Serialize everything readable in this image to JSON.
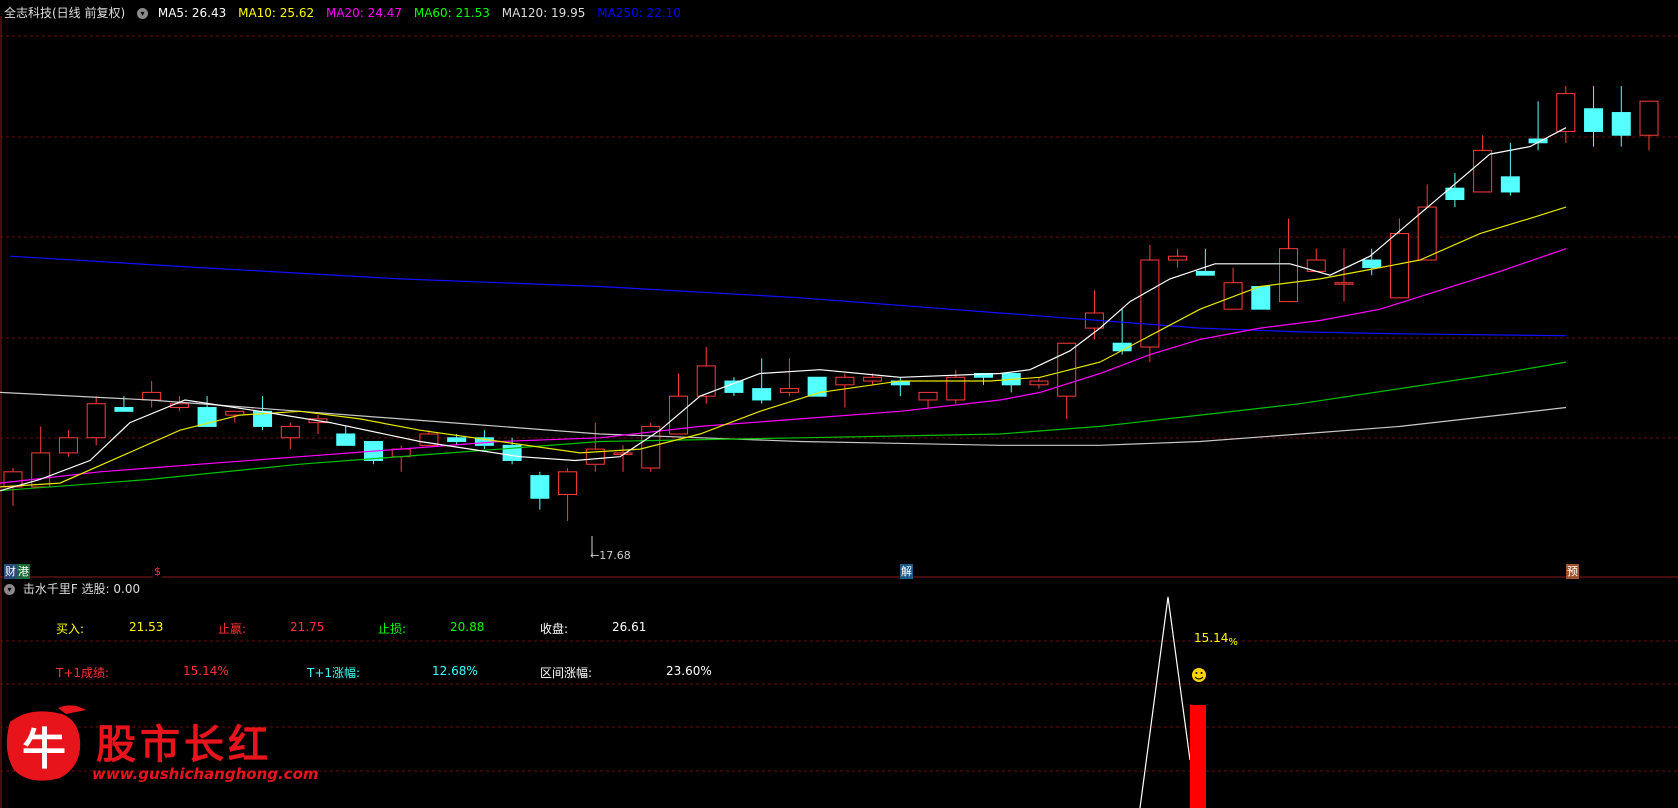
{
  "header": {
    "title": "全志科技(日线 前复权)",
    "toggle_icon": "chevron-down-icon",
    "indicators": [
      {
        "label": "MA5: 26.43",
        "color": "#ffffff"
      },
      {
        "label": "MA10: 25.62",
        "color": "#ffff00"
      },
      {
        "label": "MA20: 24.47",
        "color": "#ff00ff"
      },
      {
        "label": "MA60: 21.53",
        "color": "#00ff00"
      },
      {
        "label": "MA120: 19.95",
        "color": "#dcdcdc"
      },
      {
        "label": "MA250: 22.10",
        "color": "#0000ff"
      }
    ]
  },
  "main_chart": {
    "price_range": [
      16.8,
      31.0
    ],
    "low_marker": "←17.68",
    "candles": [
      [
        18.6,
        19.0,
        18.1,
        19.1
      ],
      [
        18.6,
        19.5,
        18.6,
        20.2
      ],
      [
        19.5,
        19.9,
        19.4,
        20.1
      ],
      [
        19.9,
        20.8,
        19.7,
        21.0
      ],
      [
        20.7,
        20.6,
        20.6,
        21.0
      ],
      [
        20.9,
        21.1,
        20.7,
        21.4
      ],
      [
        20.7,
        20.8,
        20.6,
        21.0
      ],
      [
        20.7,
        20.2,
        20.2,
        21.0
      ],
      [
        20.5,
        20.6,
        20.3,
        20.6
      ],
      [
        20.6,
        20.2,
        20.1,
        21.0
      ],
      [
        19.9,
        20.2,
        19.6,
        20.3
      ],
      [
        20.3,
        20.4,
        20.0,
        20.5
      ],
      [
        20.0,
        19.7,
        19.7,
        20.2
      ],
      [
        19.8,
        19.3,
        19.2,
        19.8
      ],
      [
        19.4,
        19.6,
        19.0,
        19.7
      ],
      [
        19.7,
        20.0,
        19.7,
        20.1
      ],
      [
        19.9,
        19.8,
        19.7,
        20.0
      ],
      [
        19.9,
        19.7,
        19.6,
        20.1
      ],
      [
        19.7,
        19.3,
        19.2,
        19.9
      ],
      [
        18.9,
        18.3,
        18.0,
        19.0
      ],
      [
        18.4,
        19.0,
        17.7,
        19.1
      ],
      [
        19.2,
        19.6,
        19.0,
        20.3
      ],
      [
        19.5,
        19.5,
        19.0,
        19.7
      ],
      [
        19.1,
        20.2,
        19.0,
        20.3
      ],
      [
        20.0,
        21.0,
        20.0,
        21.6
      ],
      [
        21.0,
        21.8,
        20.8,
        22.3
      ],
      [
        21.4,
        21.1,
        21.0,
        21.5
      ],
      [
        21.2,
        20.9,
        20.8,
        22.0
      ],
      [
        21.1,
        21.2,
        21.0,
        22.0
      ],
      [
        21.5,
        21.0,
        21.0,
        21.5
      ],
      [
        21.3,
        21.5,
        20.7,
        21.6
      ],
      [
        21.4,
        21.5,
        21.3,
        21.6
      ],
      [
        21.4,
        21.3,
        21.0,
        21.5
      ],
      [
        20.9,
        21.1,
        20.7,
        21.1
      ],
      [
        20.9,
        21.5,
        20.8,
        21.7
      ],
      [
        21.6,
        21.5,
        21.3,
        21.6
      ],
      [
        21.6,
        21.3,
        21.1,
        21.6
      ],
      [
        21.3,
        21.4,
        21.2,
        21.5
      ],
      [
        21.0,
        22.4,
        20.4,
        22.4
      ],
      [
        22.8,
        23.2,
        22.5,
        23.8
      ],
      [
        22.4,
        22.2,
        22.1,
        23.3
      ],
      [
        22.3,
        24.6,
        21.9,
        25.0
      ],
      [
        24.6,
        24.7,
        24.4,
        24.9
      ],
      [
        24.3,
        24.2,
        24.2,
        24.9
      ],
      [
        23.3,
        24.0,
        23.3,
        24.4
      ],
      [
        23.9,
        23.3,
        23.3,
        23.9
      ],
      [
        23.5,
        24.9,
        23.5,
        25.7
      ],
      [
        24.3,
        24.6,
        24.3,
        24.9
      ],
      [
        24.0,
        24.0,
        23.5,
        24.9
      ],
      [
        24.6,
        24.4,
        24.2,
        24.9
      ],
      [
        23.6,
        25.3,
        23.6,
        25.7
      ],
      [
        24.6,
        26.0,
        24.6,
        26.6
      ],
      [
        26.5,
        26.2,
        26.0,
        26.9
      ],
      [
        26.4,
        27.5,
        26.4,
        27.9
      ],
      [
        26.8,
        26.4,
        26.3,
        27.7
      ],
      [
        27.8,
        27.7,
        27.5,
        28.8
      ],
      [
        28.0,
        29.0,
        27.7,
        29.2
      ],
      [
        28.6,
        28.0,
        27.6,
        29.2
      ],
      [
        28.5,
        27.9,
        27.6,
        29.2
      ],
      [
        27.9,
        28.8,
        27.5,
        28.8
      ]
    ],
    "ma5": [
      [
        0,
        18.5
      ],
      [
        40,
        18.8
      ],
      [
        90,
        19.3
      ],
      [
        130,
        20.3
      ],
      [
        185,
        20.9
      ],
      [
        260,
        20.6
      ],
      [
        330,
        20.3
      ],
      [
        420,
        19.8
      ],
      [
        520,
        19.4
      ],
      [
        575,
        19.3
      ],
      [
        620,
        19.4
      ],
      [
        660,
        20.1
      ],
      [
        700,
        21.0
      ],
      [
        760,
        21.6
      ],
      [
        820,
        21.7
      ],
      [
        900,
        21.5
      ],
      [
        1000,
        21.6
      ],
      [
        1030,
        21.7
      ],
      [
        1070,
        22.2
      ],
      [
        1100,
        22.8
      ],
      [
        1130,
        23.5
      ],
      [
        1170,
        24.1
      ],
      [
        1215,
        24.5
      ],
      [
        1260,
        24.5
      ],
      [
        1290,
        24.5
      ],
      [
        1330,
        24.2
      ],
      [
        1370,
        24.7
      ],
      [
        1410,
        25.6
      ],
      [
        1450,
        26.5
      ],
      [
        1490,
        27.4
      ],
      [
        1530,
        27.6
      ],
      [
        1566,
        28.1
      ]
    ],
    "ma10": [
      [
        0,
        18.6
      ],
      [
        60,
        18.7
      ],
      [
        120,
        19.4
      ],
      [
        180,
        20.1
      ],
      [
        240,
        20.5
      ],
      [
        300,
        20.6
      ],
      [
        360,
        20.4
      ],
      [
        420,
        20.1
      ],
      [
        500,
        19.8
      ],
      [
        580,
        19.5
      ],
      [
        640,
        19.6
      ],
      [
        700,
        20.0
      ],
      [
        760,
        20.6
      ],
      [
        820,
        21.1
      ],
      [
        900,
        21.4
      ],
      [
        990,
        21.4
      ],
      [
        1040,
        21.5
      ],
      [
        1100,
        21.9
      ],
      [
        1150,
        22.6
      ],
      [
        1200,
        23.3
      ],
      [
        1260,
        23.9
      ],
      [
        1320,
        24.1
      ],
      [
        1380,
        24.4
      ],
      [
        1420,
        24.6
      ],
      [
        1480,
        25.3
      ],
      [
        1530,
        25.7
      ],
      [
        1566,
        26.0
      ]
    ],
    "ma20": [
      [
        0,
        18.7
      ],
      [
        100,
        19.0
      ],
      [
        200,
        19.2
      ],
      [
        300,
        19.4
      ],
      [
        400,
        19.6
      ],
      [
        500,
        19.8
      ],
      [
        600,
        19.9
      ],
      [
        700,
        20.2
      ],
      [
        800,
        20.4
      ],
      [
        900,
        20.6
      ],
      [
        1000,
        20.9
      ],
      [
        1040,
        21.1
      ],
      [
        1100,
        21.6
      ],
      [
        1150,
        22.1
      ],
      [
        1200,
        22.5
      ],
      [
        1260,
        22.8
      ],
      [
        1320,
        23.0
      ],
      [
        1380,
        23.3
      ],
      [
        1440,
        23.8
      ],
      [
        1500,
        24.3
      ],
      [
        1566,
        24.9
      ]
    ],
    "ma60": [
      [
        0,
        18.5
      ],
      [
        150,
        18.8
      ],
      [
        300,
        19.2
      ],
      [
        450,
        19.5
      ],
      [
        600,
        19.8
      ],
      [
        800,
        19.9
      ],
      [
        1000,
        20.0
      ],
      [
        1100,
        20.2
      ],
      [
        1200,
        20.5
      ],
      [
        1300,
        20.8
      ],
      [
        1400,
        21.2
      ],
      [
        1500,
        21.6
      ],
      [
        1566,
        21.9
      ]
    ],
    "ma120": [
      [
        0,
        21.1
      ],
      [
        150,
        20.9
      ],
      [
        300,
        20.6
      ],
      [
        450,
        20.3
      ],
      [
        600,
        20.0
      ],
      [
        800,
        19.8
      ],
      [
        1000,
        19.7
      ],
      [
        1100,
        19.7
      ],
      [
        1200,
        19.8
      ],
      [
        1300,
        20.0
      ],
      [
        1400,
        20.2
      ],
      [
        1500,
        20.5
      ],
      [
        1566,
        20.7
      ]
    ],
    "ma250": [
      [
        10,
        24.7
      ],
      [
        200,
        24.4
      ],
      [
        400,
        24.1
      ],
      [
        600,
        23.9
      ],
      [
        800,
        23.6
      ],
      [
        1000,
        23.2
      ],
      [
        1100,
        23.0
      ],
      [
        1200,
        22.8
      ],
      [
        1300,
        22.7
      ],
      [
        1400,
        22.65
      ],
      [
        1566,
        22.6
      ]
    ],
    "grid_rows": [
      1,
      2,
      3,
      4,
      5
    ]
  },
  "event_tags": [
    {
      "label": "财",
      "bg": "#2a4b7a",
      "color": "#ffffff"
    },
    {
      "label": "港",
      "bg": "#1c6a3a",
      "color": "#ffffff"
    },
    {
      "label": "$",
      "bg": "#000000",
      "color": "#ff3030"
    },
    {
      "label": "解",
      "bg": "#1e5a8a",
      "color": "#ffffff"
    },
    {
      "label": "预",
      "bg": "#a0522d",
      "color": "#ffffff"
    }
  ],
  "sub_header": {
    "label": "击水千里F  选股: 0.00"
  },
  "stats": {
    "buy_label": "买入:",
    "buy_value": "21.53",
    "tp_label": "止赢:",
    "tp_value": "21.75",
    "sl_label": "止损:",
    "sl_value": "20.88",
    "close_label": "收盘:",
    "close_value": "26.61",
    "t1_label": "T+1成绩:",
    "t1_value": "15.14%",
    "t1chg_label": "T+1涨幅:",
    "t1chg_value": "12.68%",
    "range_label": "区间涨幅:",
    "range_value": "23.60%"
  },
  "signal": {
    "value_label": "15.14",
    "percent_sign": "%",
    "face_icon": "smiley-icon"
  },
  "watermark": {
    "name": "股市长红",
    "url": "www.gushichanghong.com",
    "logo_char": "牛"
  }
}
